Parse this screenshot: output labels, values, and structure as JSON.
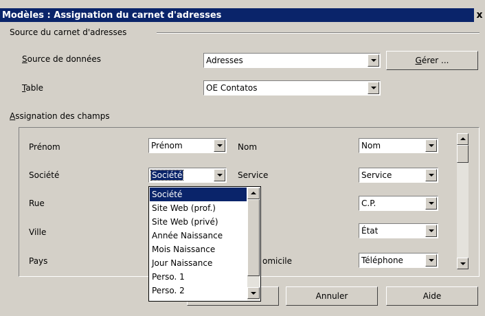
{
  "window": {
    "title": "Modèles : Assignation du carnet d'adresses",
    "close": "x"
  },
  "source_group": {
    "label": "Source du carnet d'adresses",
    "datasource": {
      "mnemonic": "S",
      "rest": "ource de données",
      "value": "Adresses"
    },
    "table": {
      "mnemonic": "T",
      "rest": "able",
      "value": "OE Contatos"
    },
    "manage_button": {
      "mnemonic": "G",
      "rest": "érer ..."
    }
  },
  "fields_group": {
    "mnemonic": "A",
    "rest": "ssignation des champs",
    "rows": [
      {
        "left_label": "Prénom",
        "left_value": "Prénom",
        "right_label": "Nom",
        "right_value": "Nom"
      },
      {
        "left_label": "Société",
        "left_value": "Société",
        "right_label": "Service",
        "right_value": "Service"
      },
      {
        "left_label": "Rue",
        "right_label": "",
        "right_value": "C.P."
      },
      {
        "left_label": "Ville",
        "right_label": "",
        "right_value": "État"
      },
      {
        "left_label": "Pays",
        "right_label": "omicile",
        "right_value": "Téléphone"
      }
    ]
  },
  "dropdown": {
    "items": [
      "Société",
      "Site Web (prof.)",
      "Site Web (privé)",
      "Année Naissance",
      "Mois Naissance",
      "Jour Naissance",
      "Perso. 1",
      "Perso. 2"
    ],
    "selected": "Société"
  },
  "buttons": {
    "cancel": "Annuler",
    "help": "Aide"
  },
  "colors": {
    "titlebar": "#0a246a",
    "face": "#d4d0c8",
    "highlight": "#0a246a"
  }
}
